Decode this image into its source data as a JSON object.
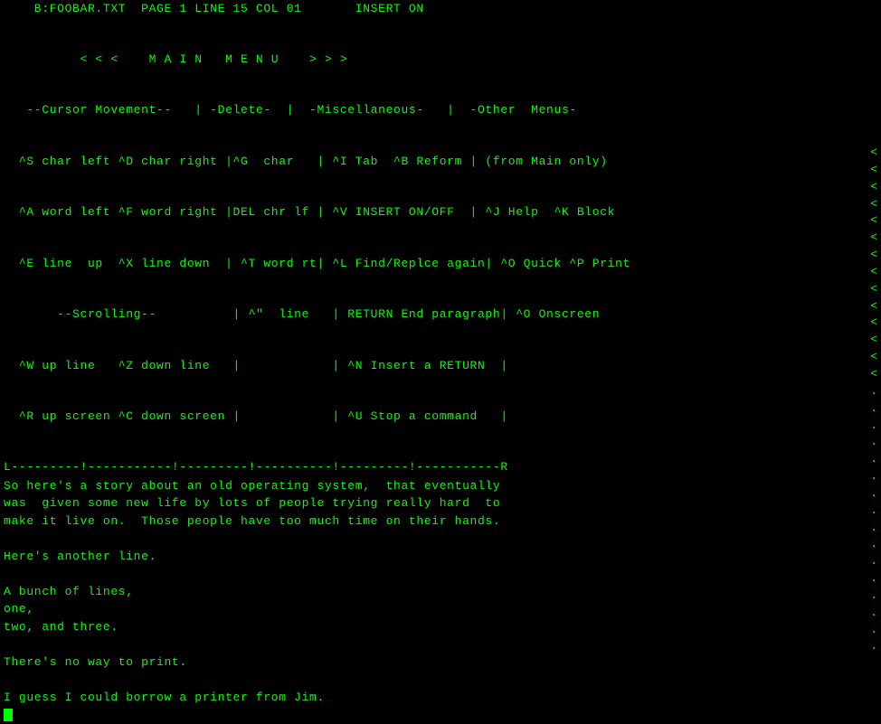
{
  "terminal": {
    "status_bar": "    B:FOOBAR.TXT  PAGE 1 LINE 15 COL 01       INSERT ON",
    "menu_title": "          < < <    M A I N   M E N U    > > >",
    "menu_line1": "   --Cursor Movement--   | -Delete-  |  -Miscellaneous-   |  -Other  Menus-",
    "menu_line2": "  ^S char left ^D char right |^G  char   | ^I Tab  ^B Reform | (from Main only)",
    "menu_line3": "  ^A word left ^F word right |DEL chr lf | ^V INSERT ON/OFF  | ^J Help  ^K Block",
    "menu_line4": "  ^E line  up  ^X line down  | ^T word rt| ^L Find/Replce again| ^O Quick ^P Print",
    "menu_line5": "       --Scrolling--          | ^\"  line   | RETURN End paragraph| ^O Onscreen",
    "menu_line6": "  ^W up line   ^Z down line   |            | ^N Insert a RETURN  |",
    "menu_line7": "  ^R up screen ^C down screen |            | ^U Stop a command   |",
    "separator": "L---------!-----------!---------!----------!---------!-----------R",
    "content_lines": [
      "So here's a story about an old operating system,  that eventually",
      "was  given some new life by lots of people trying really hard  to",
      "make it live on.  Those people have too much time on their hands.",
      "",
      "Here's another line.",
      "",
      "A bunch of lines,",
      "one,",
      "two, and three.",
      "",
      "There's no way to print.",
      "",
      "I guess I could borrow a printer from Jim.",
      ""
    ],
    "scrollbar_chars": "<<<<<<<<<<<<<<<<<<<<...........",
    "cursor_line": 13
  }
}
